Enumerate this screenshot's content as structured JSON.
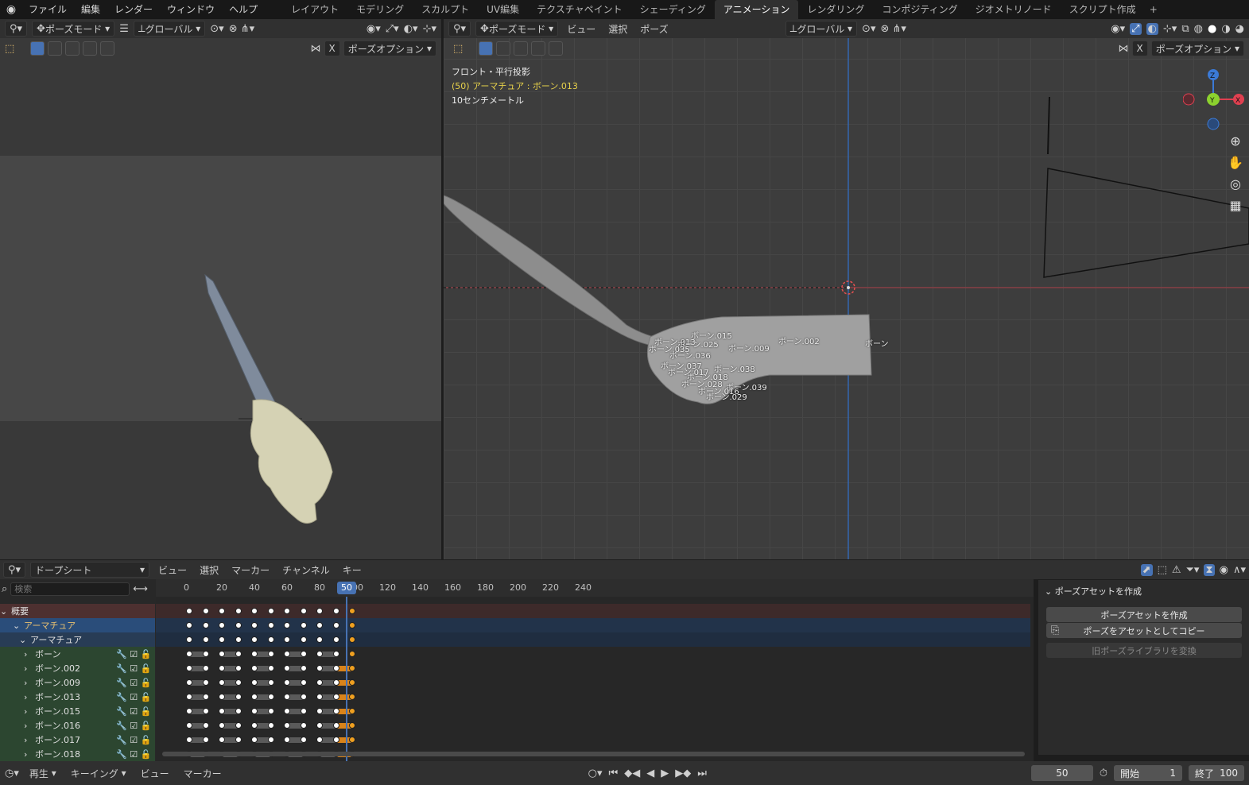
{
  "menu": [
    "ファイル",
    "編集",
    "レンダー",
    "ウィンドウ",
    "ヘルプ"
  ],
  "workspaces": [
    "レイアウト",
    "モデリング",
    "スカルプト",
    "UV編集",
    "テクスチャペイント",
    "シェーディング",
    "アニメーション",
    "レンダリング",
    "コンポジティング",
    "ジオメトリノード",
    "スクリプト作成"
  ],
  "workspace_plus": "+",
  "left_view": {
    "mode": "ポーズモード",
    "orientation": "グローバル",
    "pose_options": "ポーズオプション",
    "x_label": "X"
  },
  "right_view": {
    "mode": "ポーズモード",
    "menus": [
      "ビュー",
      "選択",
      "ポーズ"
    ],
    "orientation": "グローバル",
    "pose_options": "ポーズオプション",
    "x_label": "X",
    "overlay": {
      "projection": "フロント・平行投影",
      "selection": "(50) アーマチュア : ボーン.013",
      "scale": "10センチメートル"
    },
    "gizmo": {
      "z": "Z",
      "y": "Y",
      "x": "X"
    },
    "bones": [
      "ボーン.015",
      "ボーン.013",
      "ボーン.025",
      "ボーン.035",
      "ボーン.009",
      "ボーン.036",
      "ボーン.002",
      "ボーン",
      "ボーン.037",
      "ボーン.038",
      "ボーン.017",
      "ボーン.018",
      "ボーン.028",
      "ボーン.039",
      "ボーン.016",
      "ボーン.029"
    ]
  },
  "dopesheet": {
    "mode": "ドープシート",
    "menus": [
      "ビュー",
      "選択",
      "マーカー",
      "チャンネル",
      "キー"
    ],
    "search_placeholder": "検索",
    "ticks": [
      "0",
      "20",
      "40",
      "50",
      "60",
      "80",
      "100",
      "120",
      "140",
      "160",
      "180",
      "200",
      "220",
      "240"
    ],
    "current_frame": "50",
    "channels": [
      {
        "name": "概要",
        "kind": "summary"
      },
      {
        "name": "アーマチュア",
        "kind": "object"
      },
      {
        "name": "アーマチュア",
        "kind": "data"
      },
      {
        "name": "ボーン",
        "kind": "bone"
      },
      {
        "name": "ボーン.002",
        "kind": "bone"
      },
      {
        "name": "ボーン.009",
        "kind": "bone"
      },
      {
        "name": "ボーン.013",
        "kind": "bone"
      },
      {
        "name": "ボーン.015",
        "kind": "bone"
      },
      {
        "name": "ボーン.016",
        "kind": "bone"
      },
      {
        "name": "ボーン.017",
        "kind": "bone"
      },
      {
        "name": "ボーン.018",
        "kind": "bone"
      }
    ]
  },
  "pose_panel": {
    "title": "ポーズアセットを作成",
    "create": "ポーズアセットを作成",
    "copy": "ポーズをアセットとしてコピー",
    "convert": "旧ポーズライブラリを変換"
  },
  "footer": {
    "play": "再生",
    "keying": "キーイング",
    "view": "ビュー",
    "marker": "マーカー",
    "frame": "50",
    "start_label": "開始",
    "start": "1",
    "end_label": "終了",
    "end": "100"
  },
  "colors": {
    "accent": "#4772b3",
    "keyframe_selected": "#f0a020",
    "x_axis": "#e04050",
    "y_axis": "#8cd22e",
    "z_axis": "#3b7ad6"
  }
}
